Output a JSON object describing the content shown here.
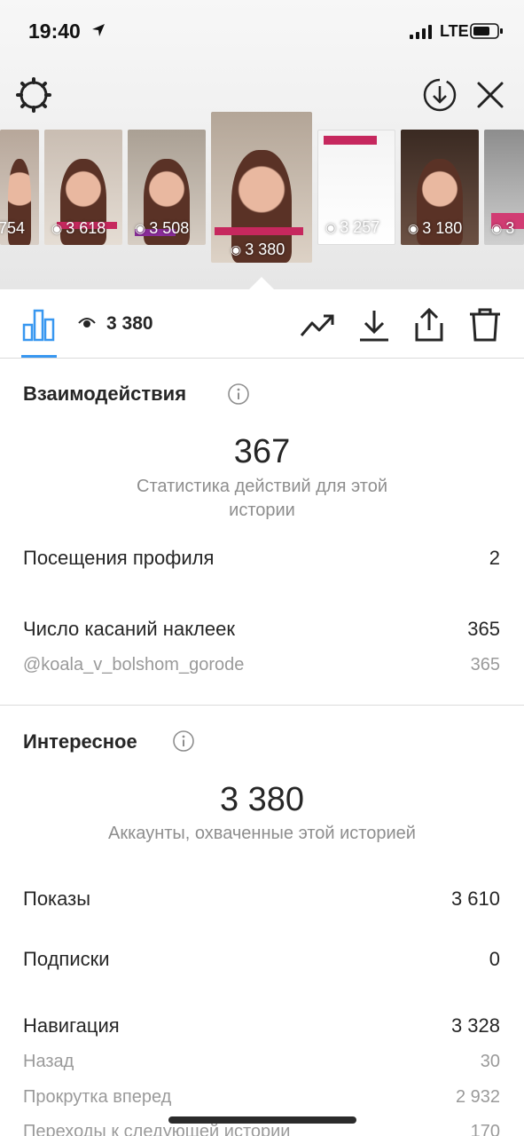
{
  "status_bar": {
    "time": "19:40",
    "network": "LTE"
  },
  "thumbnails": [
    {
      "count": "754"
    },
    {
      "count": "3 618"
    },
    {
      "count": "3 508"
    },
    {
      "count": "3 380",
      "active": true
    },
    {
      "count": "3 257"
    },
    {
      "count": "3 180"
    },
    {
      "count": "3"
    }
  ],
  "thumb_tag_text": "@koala_v_bolshom_gorode",
  "toolbar": {
    "views": "3 380"
  },
  "interactions": {
    "title": "Взаимодействия",
    "total": "367",
    "caption": "Статистика действий для этой истории",
    "rows": [
      {
        "label": "Посещения профиля",
        "value": "2"
      },
      {
        "label": "Число касаний наклеек",
        "value": "365"
      },
      {
        "label": "@koala_v_bolshom_gorode",
        "value": "365"
      }
    ]
  },
  "discovery": {
    "title": "Интересное",
    "total": "3 380",
    "caption": "Аккаунты, охваченные этой историей",
    "rows": [
      {
        "label": "Показы",
        "value": "3 610"
      },
      {
        "label": "Подписки",
        "value": "0"
      },
      {
        "label": "Навигация",
        "value": "3 328"
      },
      {
        "label": "Назад",
        "value": "30"
      },
      {
        "label": "Прокрутка вперед",
        "value": "2 932"
      },
      {
        "label": "Переходы к следующей истории",
        "value": "170"
      }
    ]
  },
  "colors": {
    "accent": "#3897f0",
    "tag": "#c6285e"
  }
}
